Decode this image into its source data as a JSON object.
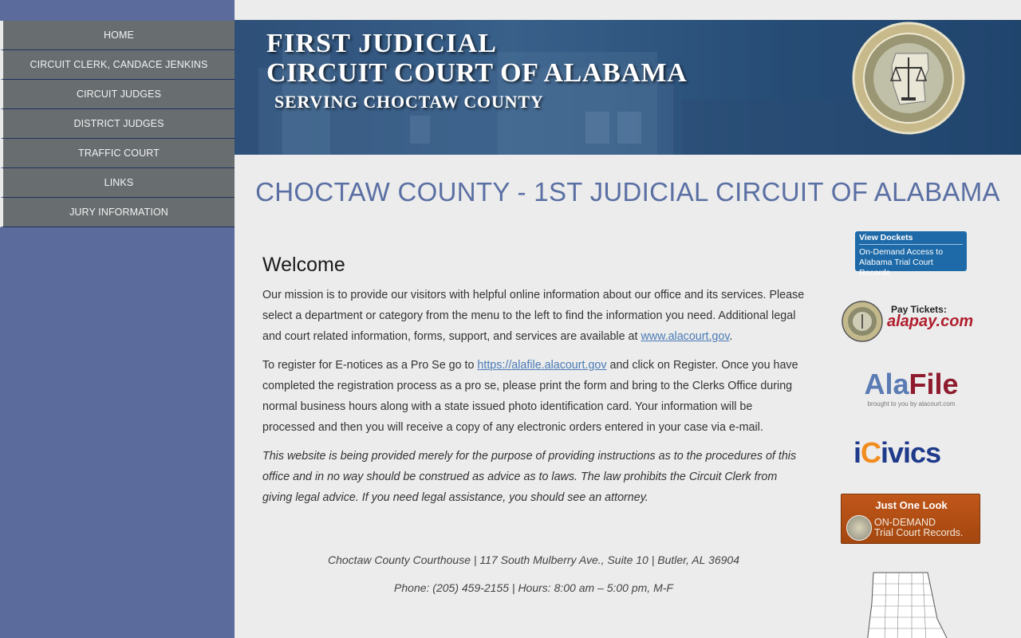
{
  "sidebar": {
    "items": [
      {
        "label": "HOME"
      },
      {
        "label": "CIRCUIT CLERK, CANDACE JENKINS"
      },
      {
        "label": "CIRCUIT JUDGES"
      },
      {
        "label": "DISTRICT JUDGES"
      },
      {
        "label": "TRAFFIC COURT"
      },
      {
        "label": "LINKS"
      },
      {
        "label": "JURY INFORMATION"
      }
    ]
  },
  "banner": {
    "line1": "FIRST JUDICIAL",
    "line2": "CIRCUIT COURT OF ALABAMA",
    "line3": "SERVING CHOCTAW COUNTY",
    "seal_icon": "unified-judicial-system-seal-icon"
  },
  "main": {
    "title": "CHOCTAW COUNTY - 1ST JUDICIAL CIRCUIT OF ALABAMA",
    "welcome_heading": "Welcome",
    "para1_text": "Our mission is to provide our visitors with helpful online information about our office and its services. Please select a department or category from the menu to the left to find the information you need. Additional legal and court related information, forms, support, and services are available at ",
    "para1_link": "www.alacourt.gov",
    "para1_end": ".",
    "para2_start": "To register for E-notices as a Pro Se go to ",
    "para2_link": "https://alafile.alacourt.gov",
    "para2_end": " and click on Register. Once you have completed the registration process as a pro se, please print the form and bring to the Clerks Office during normal business hours along with a state issued photo identification card. Your information will be processed and then you will receive a copy of any electronic orders entered in your case via e-mail.",
    "disclaimer": "This website is being provided merely for the purpose of providing instructions as to the procedures of this office and in no way should be construed as advice as to laws. The law prohibits the Circuit Clerk from giving legal advice. If you need legal assistance, you should see an attorney.",
    "address": "Choctaw County Courthouse | 117 South Mulberry Ave., Suite 10 | Butler, AL 36904",
    "phone_hours": "Phone: (205) 459-2155 | Hours: 8:00 am – 5:00 pm, M-F"
  },
  "badges": {
    "dockets_title": "View Dockets",
    "dockets_sub1": "On-Demand Access to",
    "dockets_sub2": "Alabama Trial Court Records",
    "paytix_label": "Pay Tickets:",
    "paytix_site": "alapay.com",
    "alafile_ala": "Ala",
    "alafile_file": "File",
    "alafile_sub": "brought to you by alacourt.com",
    "icivics_i": "i",
    "icivics_c": "C",
    "icivics_rest": "ivics",
    "onelook_title": "Just One Look",
    "onelook_l1": "ON-DEMAND",
    "onelook_l2": "Trial Court Records."
  },
  "colors": {
    "sidebar_bg": "#5a6b9c",
    "nav_item_bg": "#686e70",
    "title_color": "#5a6fa3",
    "link_color": "#4a7bb7"
  }
}
